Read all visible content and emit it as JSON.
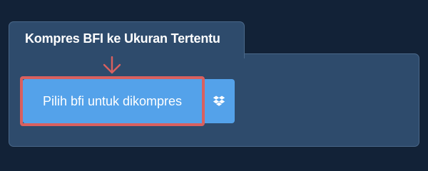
{
  "panel": {
    "title": "Kompres BFI ke Ukuran Tertentu"
  },
  "upload": {
    "button_label": "Pilih bfi untuk dikompres",
    "dropbox_icon": "dropbox-icon"
  },
  "colors": {
    "page_background": "#122237",
    "panel_background": "#2e4b6c",
    "button_background": "#54a2ea",
    "highlight": "#d9605f",
    "text": "#ffffff"
  }
}
